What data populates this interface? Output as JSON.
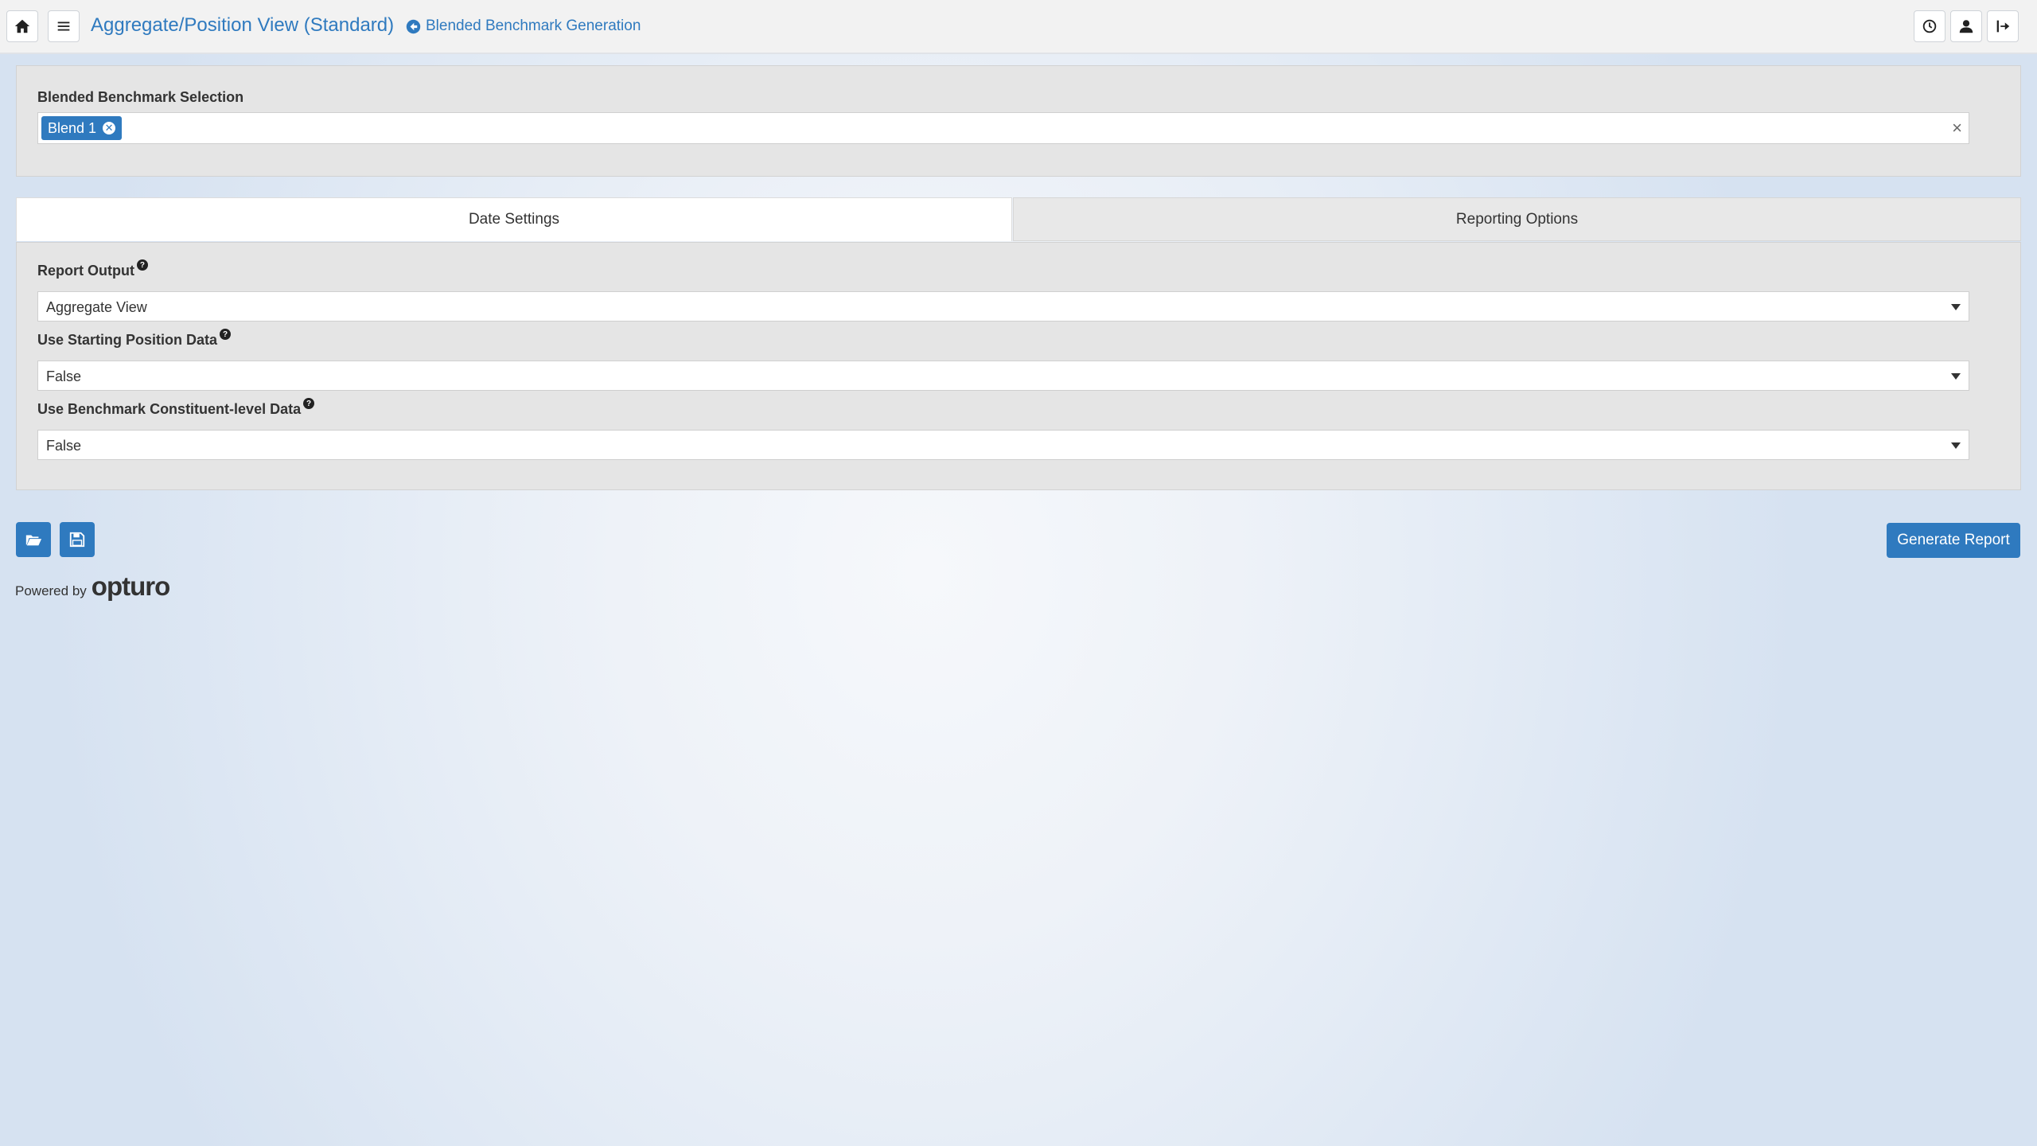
{
  "header": {
    "title": "Aggregate/Position View (Standard)",
    "back_link": "Blended Benchmark Generation",
    "icons": [
      "home-icon",
      "menu-icon",
      "history-icon",
      "user-icon",
      "logout-icon"
    ]
  },
  "benchmark": {
    "label": "Blended Benchmark Selection",
    "selected_tag": "Blend 1",
    "clear_symbol": "×"
  },
  "tabs": [
    {
      "label": "Date Settings",
      "active": true
    },
    {
      "label": "Reporting Options",
      "active": false
    }
  ],
  "fields": [
    {
      "label": "Report Output",
      "value": "Aggregate View"
    },
    {
      "label": "Use Starting Position Data",
      "value": "False"
    },
    {
      "label": "Use Benchmark Constituent-level Data",
      "value": "False"
    }
  ],
  "actions": {
    "generate": "Generate Report",
    "icons": [
      "folder-open-icon",
      "save-icon"
    ]
  },
  "footer": {
    "powered_by": "Powered by",
    "brand": "opturo"
  },
  "colors": {
    "accent": "#2f7abf",
    "panel": "#e5e5e5",
    "topbar": "#f2f2f2"
  }
}
